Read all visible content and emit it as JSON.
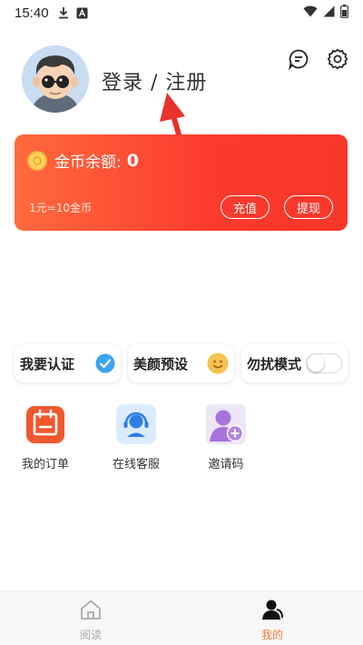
{
  "status_bar": {
    "time": "15:40",
    "icons": [
      "download-icon",
      "a-badge-icon",
      "wifi-icon",
      "signal-icon",
      "battery-icon"
    ]
  },
  "header": {
    "login_text": "登录 / 注册",
    "icons": [
      "message-icon",
      "settings-icon"
    ]
  },
  "wallet": {
    "label": "金币余额:",
    "balance": "0",
    "rate": "1元=10金币",
    "recharge_label": "充值",
    "withdraw_label": "提现"
  },
  "quick_actions": [
    {
      "label": "我要认证",
      "icon": "verified-check-icon"
    },
    {
      "label": "美颜预设",
      "icon": "smile-face-icon"
    },
    {
      "label": "勿扰模式",
      "toggle_on": false
    }
  ],
  "grid": [
    {
      "label": "我的订单",
      "icon": "calendar-icon"
    },
    {
      "label": "在线客服",
      "icon": "customer-service-icon"
    },
    {
      "label": "邀请码",
      "icon": "add-user-icon"
    }
  ],
  "bottom_nav": [
    {
      "label": "阅读",
      "icon": "home-icon",
      "active": false
    },
    {
      "label": "我的",
      "icon": "profile-icon",
      "active": true
    }
  ],
  "colors": {
    "accent_orange": "#f0803b",
    "card_start": "#ff6a3d",
    "card_end": "#f7372a",
    "annotation_red": "#e8322a"
  }
}
